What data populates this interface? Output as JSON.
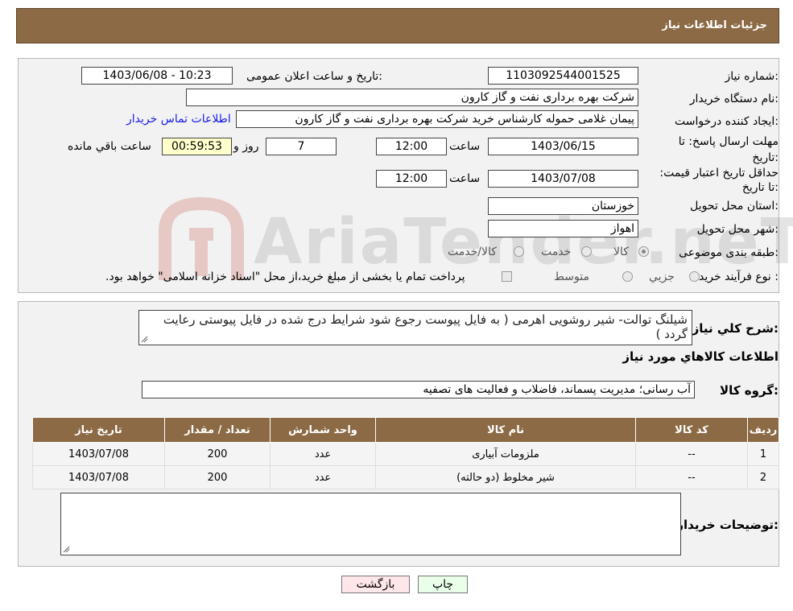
{
  "header": {
    "title": "جزئیات اطلاعات نیاز"
  },
  "form": {
    "need_number_label": "شماره نیاز:",
    "need_number": "1103092544001525",
    "announce_label": "تاریخ و ساعت اعلان عمومی:",
    "announce_value": "1403/06/08 - 10:23",
    "buyer_org_label": "نام دستگاه خریدار:",
    "buyer_org": "شرکت بهره برداری نفت و گاز کارون",
    "creator_label": "ایجاد کننده درخواست:",
    "creator": "پیمان غلامی حموله کارشناس خرید شرکت بهره برداری نفت و گاز کارون",
    "contact_link": "اطلاعات تماس خریدار",
    "deadline_label": "مهلت ارسال پاسخ: تا تاریخ:",
    "deadline_date": "1403/06/15",
    "hour_label": "ساعت",
    "deadline_time": "12:00",
    "days": "7",
    "days_label": "روز و",
    "remaining": "00:59:53",
    "remaining_label": "ساعت باقي مانده",
    "validity_label": "حداقل تاریخ اعتبار قیمت: تا تاریخ:",
    "validity_date": "1403/07/08",
    "validity_time": "12:00",
    "province_label": "استان محل تحویل:",
    "province": "خوزستان",
    "city_label": "شهر محل تحویل:",
    "city": "اهواز",
    "category_label": "طبقه بندی موضوعی:",
    "category_options": [
      "کالا",
      "خدمت",
      "کالا/خدمت"
    ],
    "purchase_type_label": "نوع فرآیند خرید :",
    "purchase_options": [
      "جزيي",
      "متوسط"
    ],
    "purchase_note": "پرداخت تمام یا بخشی از مبلغ خرید،از محل \"اسناد خزانه اسلامی\" خواهد بود."
  },
  "description": {
    "label": "شرح کلي نياز:",
    "text": "شیلنگ توالت- شیر روشویی اهرمی ( به فایل پیوست رجوع شود شرایط درج شده در فایل پیوستی رعایت گردد )",
    "goods_info_title": "اطلاعات کالاهاي مورد نياز",
    "goods_group_label": "گروه کالا:",
    "goods_group": "آب رسانی؛ مدیریت پسماند، فاضلاب و فعالیت های تصفیه"
  },
  "table": {
    "headers": [
      "رديف",
      "کد کالا",
      "نام کالا",
      "واحد شمارش",
      "تعداد / مقدار",
      "تاریخ نیاز"
    ],
    "rows": [
      [
        "1",
        "--",
        "ملزومات آبیاری",
        "عدد",
        "200",
        "1403/07/08"
      ],
      [
        "2",
        "--",
        "شیر مخلوط (دو حالته)",
        "عدد",
        "200",
        "1403/07/08"
      ]
    ]
  },
  "buyer_notes": {
    "label": "توضیحات خریدار:",
    "value": ""
  },
  "buttons": {
    "print": "چاپ",
    "back": "بازگشت"
  },
  "watermark": {
    "text": "AriaTender.neT"
  }
}
